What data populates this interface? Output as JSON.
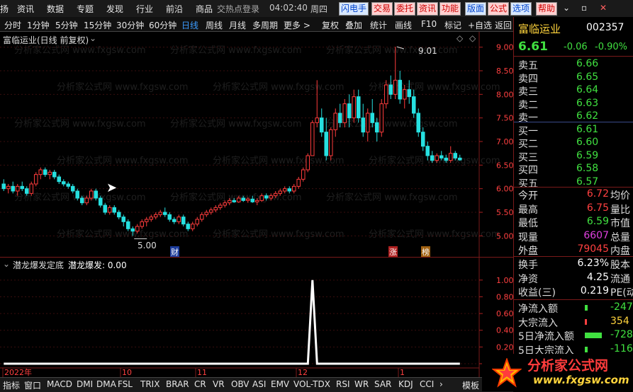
{
  "menu": {
    "items": [
      "扬",
      "资讯",
      "数据",
      "专题",
      "发现",
      "行业",
      "前沿",
      "商品"
    ],
    "search_text": "交热点登录",
    "clock": "04:02:40",
    "weekday": "周四",
    "buttons": [
      "闪电手",
      "交易",
      "委托",
      "资讯",
      "功能",
      "版面",
      "公式",
      "选项",
      "帮助"
    ],
    "window_controls": [
      "⌄",
      "▫",
      "✕"
    ]
  },
  "periods": {
    "items": [
      "分时",
      "1分钟",
      "5分钟",
      "15分钟",
      "30分钟",
      "60分钟",
      "日线",
      "周线",
      "月线",
      "多周期",
      "更多 >"
    ],
    "active": "日线",
    "tools": [
      "复权",
      "叠加",
      "统计",
      "画线",
      "F10",
      "标记",
      "+自选",
      "返回"
    ]
  },
  "main_chart": {
    "title": "富临运业(日线 前复权)",
    "high_label": "9.01",
    "low_label": "5.00",
    "events": [
      "财",
      "涨",
      "榜"
    ],
    "watermark": "分析家公式网 www.fxgsw.com"
  },
  "sub_chart": {
    "title": "潜龙爆发定底",
    "value_label": "潜龙爆发: 0.00",
    "x_labels": [
      "2022年",
      "10",
      "11",
      "12",
      "1"
    ]
  },
  "chart_data": [
    {
      "type": "candlestick",
      "title": "富临运业(日线 前复权)",
      "ylim": [
        4.75,
        9.25
      ],
      "y_ticks": [
        "9.00",
        "8.50",
        "8.00",
        "7.50",
        "7.00",
        "6.50",
        "6.00",
        "5.50",
        "5.00"
      ],
      "y_tick_values": [
        9.0,
        8.5,
        8.0,
        7.5,
        7.0,
        6.5,
        6.0,
        5.5,
        5.0
      ],
      "ohlc": [
        [
          6.1,
          6.2,
          5.95,
          6.0
        ],
        [
          6.0,
          6.1,
          5.9,
          6.05
        ],
        [
          6.05,
          6.15,
          5.9,
          5.95
        ],
        [
          5.95,
          6.1,
          5.85,
          6.05
        ],
        [
          6.05,
          6.15,
          5.95,
          6.0
        ],
        [
          6.0,
          6.05,
          5.85,
          5.9
        ],
        [
          5.9,
          6.15,
          5.85,
          6.1
        ],
        [
          6.1,
          6.35,
          6.05,
          6.3
        ],
        [
          6.3,
          6.45,
          6.2,
          6.4
        ],
        [
          6.4,
          6.45,
          6.25,
          6.3
        ],
        [
          6.3,
          6.4,
          6.2,
          6.35
        ],
        [
          6.35,
          6.4,
          6.2,
          6.25
        ],
        [
          6.25,
          6.3,
          6.1,
          6.15
        ],
        [
          6.15,
          6.2,
          6.05,
          6.1
        ],
        [
          6.1,
          6.15,
          6.0,
          6.05
        ],
        [
          6.05,
          6.1,
          5.9,
          5.95
        ],
        [
          5.95,
          6.0,
          5.75,
          5.8
        ],
        [
          5.8,
          5.85,
          5.65,
          5.7
        ],
        [
          5.7,
          5.85,
          5.65,
          5.8
        ],
        [
          5.8,
          6.0,
          5.75,
          5.95
        ],
        [
          5.95,
          6.0,
          5.75,
          5.8
        ],
        [
          5.8,
          5.85,
          5.6,
          5.65
        ],
        [
          5.65,
          5.7,
          5.45,
          5.5
        ],
        [
          5.5,
          5.65,
          5.45,
          5.6
        ],
        [
          5.6,
          5.65,
          5.45,
          5.5
        ],
        [
          5.5,
          5.55,
          5.35,
          5.4
        ],
        [
          5.4,
          5.45,
          5.2,
          5.3
        ],
        [
          5.3,
          5.35,
          5.1,
          5.15
        ],
        [
          5.15,
          5.2,
          5.0,
          5.1
        ],
        [
          5.1,
          5.25,
          5.05,
          5.2
        ],
        [
          5.2,
          5.35,
          5.15,
          5.3
        ],
        [
          5.3,
          5.4,
          5.2,
          5.35
        ],
        [
          5.35,
          5.45,
          5.3,
          5.4
        ],
        [
          5.4,
          5.5,
          5.35,
          5.45
        ],
        [
          5.45,
          5.55,
          5.4,
          5.5
        ],
        [
          5.5,
          5.6,
          5.4,
          5.45
        ],
        [
          5.45,
          5.5,
          5.3,
          5.35
        ],
        [
          5.35,
          5.4,
          5.25,
          5.3
        ],
        [
          5.3,
          5.45,
          5.25,
          5.4
        ],
        [
          5.4,
          5.45,
          5.2,
          5.25
        ],
        [
          5.25,
          5.3,
          5.1,
          5.15
        ],
        [
          5.15,
          5.3,
          5.1,
          5.25
        ],
        [
          5.25,
          5.4,
          5.2,
          5.35
        ],
        [
          5.35,
          5.5,
          5.3,
          5.45
        ],
        [
          5.45,
          5.55,
          5.4,
          5.5
        ],
        [
          5.5,
          5.6,
          5.45,
          5.55
        ],
        [
          5.55,
          5.65,
          5.5,
          5.6
        ],
        [
          5.6,
          5.7,
          5.55,
          5.65
        ],
        [
          5.65,
          5.75,
          5.6,
          5.7
        ],
        [
          5.7,
          5.8,
          5.65,
          5.75
        ],
        [
          5.75,
          5.8,
          5.7,
          5.72
        ],
        [
          5.72,
          5.85,
          5.7,
          5.8
        ],
        [
          5.8,
          5.85,
          5.72,
          5.75
        ],
        [
          5.75,
          5.82,
          5.7,
          5.78
        ],
        [
          5.78,
          5.85,
          5.7,
          5.72
        ],
        [
          5.72,
          5.8,
          5.65,
          5.75
        ],
        [
          5.75,
          5.9,
          5.72,
          5.85
        ],
        [
          5.85,
          5.9,
          5.75,
          5.8
        ],
        [
          5.8,
          5.9,
          5.75,
          5.85
        ],
        [
          5.85,
          5.95,
          5.8,
          5.9
        ],
        [
          5.9,
          6.0,
          5.85,
          5.95
        ],
        [
          5.95,
          6.05,
          5.9,
          6.0
        ],
        [
          6.0,
          6.05,
          5.9,
          5.95
        ],
        [
          5.95,
          6.1,
          5.9,
          6.05
        ],
        [
          6.05,
          6.25,
          6.0,
          6.2
        ],
        [
          6.2,
          6.45,
          6.15,
          6.4
        ],
        [
          6.4,
          6.75,
          6.35,
          6.7
        ],
        [
          6.7,
          7.45,
          6.7,
          7.4
        ],
        [
          7.4,
          8.3,
          7.3,
          7.5
        ],
        [
          7.5,
          7.7,
          7.1,
          7.2
        ],
        [
          7.2,
          7.5,
          6.6,
          6.7
        ],
        [
          6.7,
          7.3,
          6.6,
          7.25
        ],
        [
          7.25,
          7.7,
          7.1,
          7.6
        ],
        [
          7.6,
          7.8,
          7.3,
          7.4
        ],
        [
          7.4,
          7.9,
          7.3,
          7.8
        ],
        [
          7.8,
          8.0,
          7.3,
          7.5
        ],
        [
          7.5,
          8.1,
          7.4,
          7.95
        ],
        [
          7.95,
          8.1,
          7.4,
          7.5
        ],
        [
          7.5,
          7.8,
          7.1,
          7.2
        ],
        [
          7.2,
          7.7,
          7.0,
          7.6
        ],
        [
          7.6,
          7.9,
          7.3,
          7.4
        ],
        [
          7.4,
          7.5,
          7.0,
          7.2
        ],
        [
          7.2,
          7.9,
          7.1,
          7.8
        ],
        [
          7.8,
          8.3,
          7.7,
          8.2
        ],
        [
          8.2,
          8.4,
          7.9,
          8.0
        ],
        [
          8.0,
          9.01,
          7.9,
          8.3
        ],
        [
          8.3,
          8.5,
          7.8,
          7.9
        ],
        [
          7.9,
          8.2,
          7.7,
          8.1
        ],
        [
          8.1,
          8.3,
          7.8,
          7.95
        ],
        [
          7.95,
          8.1,
          7.5,
          7.6
        ],
        [
          7.6,
          7.7,
          7.1,
          7.2
        ],
        [
          7.2,
          7.3,
          6.8,
          6.9
        ],
        [
          6.9,
          7.0,
          6.6,
          6.7
        ],
        [
          6.7,
          6.8,
          6.55,
          6.6
        ],
        [
          6.6,
          6.75,
          6.55,
          6.7
        ],
        [
          6.7,
          6.8,
          6.6,
          6.65
        ],
        [
          6.65,
          6.72,
          6.55,
          6.6
        ],
        [
          6.6,
          6.9,
          6.55,
          6.75
        ],
        [
          6.75,
          6.8,
          6.6,
          6.65
        ],
        [
          6.65,
          6.72,
          6.59,
          6.61
        ]
      ]
    },
    {
      "type": "line",
      "series": [
        {
          "name": "潜龙爆发",
          "values": [
            0,
            0,
            0,
            0,
            0,
            0,
            0,
            0,
            0,
            0,
            0,
            0,
            0,
            0,
            0,
            0,
            0,
            0,
            0,
            0,
            0,
            0,
            0,
            0,
            0,
            0,
            0,
            0,
            0,
            0,
            0,
            0,
            0,
            0,
            0,
            0,
            0,
            0,
            0,
            0,
            0,
            0,
            0,
            0,
            0,
            0,
            0,
            0,
            0,
            0,
            0,
            0,
            0,
            0,
            0,
            0,
            0,
            0,
            0,
            0,
            0,
            0,
            0,
            0,
            0,
            0,
            0,
            1,
            0,
            0,
            0,
            0,
            0,
            0,
            0,
            0,
            0,
            0,
            0,
            0,
            0,
            0,
            0,
            0,
            0,
            0,
            0,
            0,
            0,
            0,
            0,
            0,
            0,
            0,
            0,
            0,
            0,
            0,
            0,
            0
          ]
        }
      ],
      "ylim": [
        0,
        1.1
      ],
      "y_ticks": [
        "1.00",
        "0.80",
        "0.60",
        "0.40",
        "0.20",
        "0.00"
      ],
      "y_tick_values": [
        1.0,
        0.8,
        0.6,
        0.4,
        0.2,
        0.0
      ]
    }
  ],
  "quote": {
    "name": "富临运业",
    "code": "002357",
    "price": "6.61",
    "change": "-0.06",
    "change_pct": "-0.90%",
    "asks": [
      {
        "label": "卖五",
        "price": "6.66"
      },
      {
        "label": "卖四",
        "price": "6.65"
      },
      {
        "label": "卖三",
        "price": "6.64"
      },
      {
        "label": "卖二",
        "price": "6.63"
      },
      {
        "label": "卖一",
        "price": "6.62"
      }
    ],
    "bids": [
      {
        "label": "买一",
        "price": "6.61"
      },
      {
        "label": "买二",
        "price": "6.60"
      },
      {
        "label": "买三",
        "price": "6.59"
      },
      {
        "label": "买四",
        "price": "6.58"
      },
      {
        "label": "买五",
        "price": "6.57"
      }
    ],
    "stats": [
      {
        "l1": "今开",
        "v1": "6.72",
        "l2": "均价"
      },
      {
        "l1": "最高",
        "v1": "6.75",
        "l2": "量比"
      },
      {
        "l1": "最低",
        "v1": "6.59",
        "l2": "市值"
      },
      {
        "l1": "现量",
        "v1": "6607",
        "l2": "总量"
      },
      {
        "l1": "外盘",
        "v1": "79045",
        "l2": "内盘"
      }
    ],
    "stats2": [
      {
        "l1": "换手",
        "v1": "6.23%",
        "l2": "股本"
      },
      {
        "l1": "净资",
        "v1": "4.25",
        "l2": "流通"
      },
      {
        "l1": "收益(三)",
        "v1": "0.219",
        "l2": "PE(动)"
      }
    ],
    "flows": [
      {
        "label": "净流入额",
        "value": "-247",
        "bar": 0.05
      },
      {
        "label": "大宗流入",
        "value": "354",
        "bar": 0.02
      },
      {
        "label": "5日净流入额",
        "value": "-728",
        "bar": 0.3
      },
      {
        "label": "5日大宗流入",
        "value": "-116",
        "bar": 0.05
      }
    ]
  },
  "bottom_tabs": [
    "指标",
    "窗口",
    "MACD",
    "DMI",
    "DMA",
    "FSL",
    "TRIX",
    "BRAR",
    "CR",
    "VR",
    "OBV",
    "ASI",
    "EMV",
    "VOL-TDX",
    "RSI",
    "WR",
    "SAR",
    "KDJ",
    "CCI",
    "›",
    "模板"
  ],
  "logo": {
    "cn": "分析家公式网",
    "url": "www.fxgsw.com"
  }
}
